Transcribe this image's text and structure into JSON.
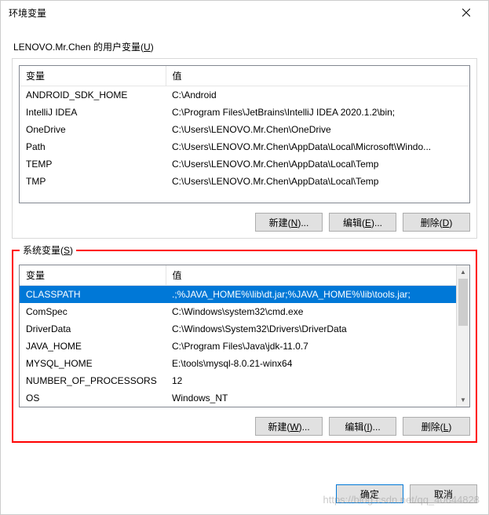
{
  "dialog": {
    "title": "环境变量"
  },
  "user_vars": {
    "label_prefix": "LENOVO.Mr.Chen 的用户变量(",
    "label_accel": "U",
    "label_suffix": ")",
    "headers": {
      "name": "变量",
      "value": "值"
    },
    "rows": [
      {
        "name": "ANDROID_SDK_HOME",
        "value": "C:\\Android"
      },
      {
        "name": "IntelliJ IDEA",
        "value": "C:\\Program Files\\JetBrains\\IntelliJ IDEA 2020.1.2\\bin;"
      },
      {
        "name": "OneDrive",
        "value": "C:\\Users\\LENOVO.Mr.Chen\\OneDrive"
      },
      {
        "name": "Path",
        "value": "C:\\Users\\LENOVO.Mr.Chen\\AppData\\Local\\Microsoft\\Windo..."
      },
      {
        "name": "TEMP",
        "value": "C:\\Users\\LENOVO.Mr.Chen\\AppData\\Local\\Temp"
      },
      {
        "name": "TMP",
        "value": "C:\\Users\\LENOVO.Mr.Chen\\AppData\\Local\\Temp"
      }
    ],
    "buttons": {
      "new_prefix": "新建(",
      "new_accel": "N",
      "new_suffix": ")...",
      "edit_prefix": "编辑(",
      "edit_accel": "E",
      "edit_suffix": ")...",
      "delete_prefix": "删除(",
      "delete_accel": "D",
      "delete_suffix": ")"
    }
  },
  "sys_vars": {
    "label_prefix": "系统变量(",
    "label_accel": "S",
    "label_suffix": ")",
    "headers": {
      "name": "变量",
      "value": "值"
    },
    "rows": [
      {
        "name": "CLASSPATH",
        "value": ".;%JAVA_HOME%\\lib\\dt.jar;%JAVA_HOME%\\lib\\tools.jar;",
        "selected": true
      },
      {
        "name": "ComSpec",
        "value": "C:\\Windows\\system32\\cmd.exe"
      },
      {
        "name": "DriverData",
        "value": "C:\\Windows\\System32\\Drivers\\DriverData"
      },
      {
        "name": "JAVA_HOME",
        "value": "C:\\Program Files\\Java\\jdk-11.0.7"
      },
      {
        "name": "MYSQL_HOME",
        "value": "E:\\tools\\mysql-8.0.21-winx64"
      },
      {
        "name": "NUMBER_OF_PROCESSORS",
        "value": "12"
      },
      {
        "name": "OS",
        "value": "Windows_NT"
      }
    ],
    "buttons": {
      "new_prefix": "新建(",
      "new_accel": "W",
      "new_suffix": ")...",
      "edit_prefix": "编辑(",
      "edit_accel": "I",
      "edit_suffix": ")...",
      "delete_prefix": "删除(",
      "delete_accel": "L",
      "delete_suffix": ")"
    }
  },
  "footer": {
    "ok": "确定",
    "cancel": "取消"
  },
  "watermark": "https://blog.csdn.net/qq_40644828"
}
